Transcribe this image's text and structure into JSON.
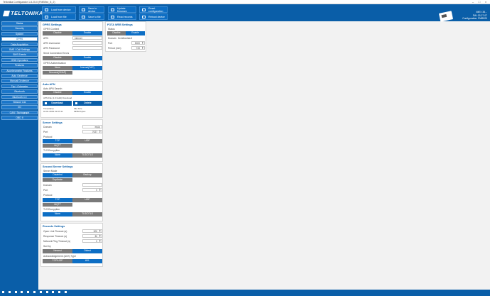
{
  "window": {
    "title": "Teltonika Configurator 1.8.25.0 (FMB9xx_8_2)"
  },
  "header": {
    "logo_text": "TELTONIKA",
    "buttons": [
      {
        "label": "Load from device"
      },
      {
        "label": "Save to device"
      },
      {
        "label": "Update firmware"
      },
      {
        "label": "Reset configuration"
      },
      {
        "label": "Load from file"
      },
      {
        "label": "Save to file"
      },
      {
        "label": "Read records"
      },
      {
        "label": "Reboot device"
      }
    ],
    "device_info": [
      {
        "text": "IMEI: 35..."
      },
      {
        "text": "FW: 03.27.07"
      },
      {
        "text": "Configuration: FMB920"
      }
    ]
  },
  "sidebar": {
    "items": [
      {
        "label": "Status"
      },
      {
        "label": "Security"
      },
      {
        "label": "System"
      },
      {
        "label": "GPRS"
      },
      {
        "label": "Data Acquisition"
      },
      {
        "label": "SMS \\ Call Settings"
      },
      {
        "label": "SMS Events"
      },
      {
        "label": "GSM Operators"
      },
      {
        "label": "Features"
      },
      {
        "label": "Accelerometer Features"
      },
      {
        "label": "Auto Geofence"
      },
      {
        "label": "Manual Geofence"
      },
      {
        "label": "Trip \\ Odometer"
      },
      {
        "label": "Bluetooth"
      },
      {
        "label": "Bluetooth 4.0"
      },
      {
        "label": "Beacon List"
      },
      {
        "label": "I/O"
      },
      {
        "label": "CAN \\ Tachograph"
      },
      {
        "label": "OBD II"
      }
    ]
  },
  "gprs": {
    "title": "GPRS Settings",
    "context_label": "GPRS Context",
    "disable": "Disable",
    "enable": "Enable",
    "apn_label": "APN",
    "apn_value": "internet",
    "user_label": "APN Username",
    "pass_label": "APN Password",
    "conn_label": "Send Connection Errors",
    "auth_label": "GPRS Authentication",
    "auth_none": "None",
    "auth_normal": "Normal(PAP)",
    "auth_secured": "Secured(CHAP)"
  },
  "fota": {
    "title": "FOTA WEB Settings",
    "status_label": "Status",
    "disable": "Disable",
    "enable": "Enable",
    "domain_label": "Domain",
    "domain_value": "fm.teltonika.lt",
    "port_label": "Port",
    "port_value": "5000",
    "period_label": "Period (min)",
    "period_value": "720"
  },
  "agps": {
    "title": "Auto APN",
    "search_label": "Auto APN Search",
    "disable": "Disable",
    "enable": "Enable",
    "file_label": "APN File (1.0 build) Download",
    "download": "Download",
    "delete": "Delete",
    "left_info": "Timestamp",
    "left_date": "01.01.2019 21:07:31",
    "right_info": "File Size",
    "right_size": "39354 bytes"
  },
  "server": {
    "title": "Server Settings",
    "domain_label": "Domain",
    "domain_value": "my.ip",
    "port_label": "Port",
    "port_value": "7027",
    "protocol_label": "Protocol",
    "tcp": "TCP",
    "udp": "UDP",
    "mqtt": "MQTT",
    "tls_label": "TLS Encryption",
    "none": "None",
    "tls": "TLS/DTLS"
  },
  "second": {
    "title": "Second Server Settings",
    "mode_label": "Server Mode",
    "disabled": "Disabled",
    "backup": "Backup",
    "duplicate": "Duplicate",
    "domain_label": "Domain",
    "port_label": "Port",
    "port_value": "0",
    "protocol_label": "Protocol",
    "tcp": "TCP",
    "udp": "UDP",
    "mqtt": "MQTT",
    "tls_label": "TLS Encryption",
    "none": "None",
    "tls": "TLS/DTLS"
  },
  "records": {
    "title": "Records Settings",
    "open_label": "Open Link Timeout (s)",
    "open_value": "300",
    "resp_label": "Response Timeout (s)",
    "resp_value": "30",
    "ping_label": "Network Ping Timeout (s)",
    "ping_value": "0",
    "sort_label": "Sort by",
    "newest": "Newest",
    "oldest": "Oldest",
    "ack_label": "Acknowledgement (ACK) Type",
    "tcpudp": "TCP/UDP",
    "ack": "AVL"
  }
}
